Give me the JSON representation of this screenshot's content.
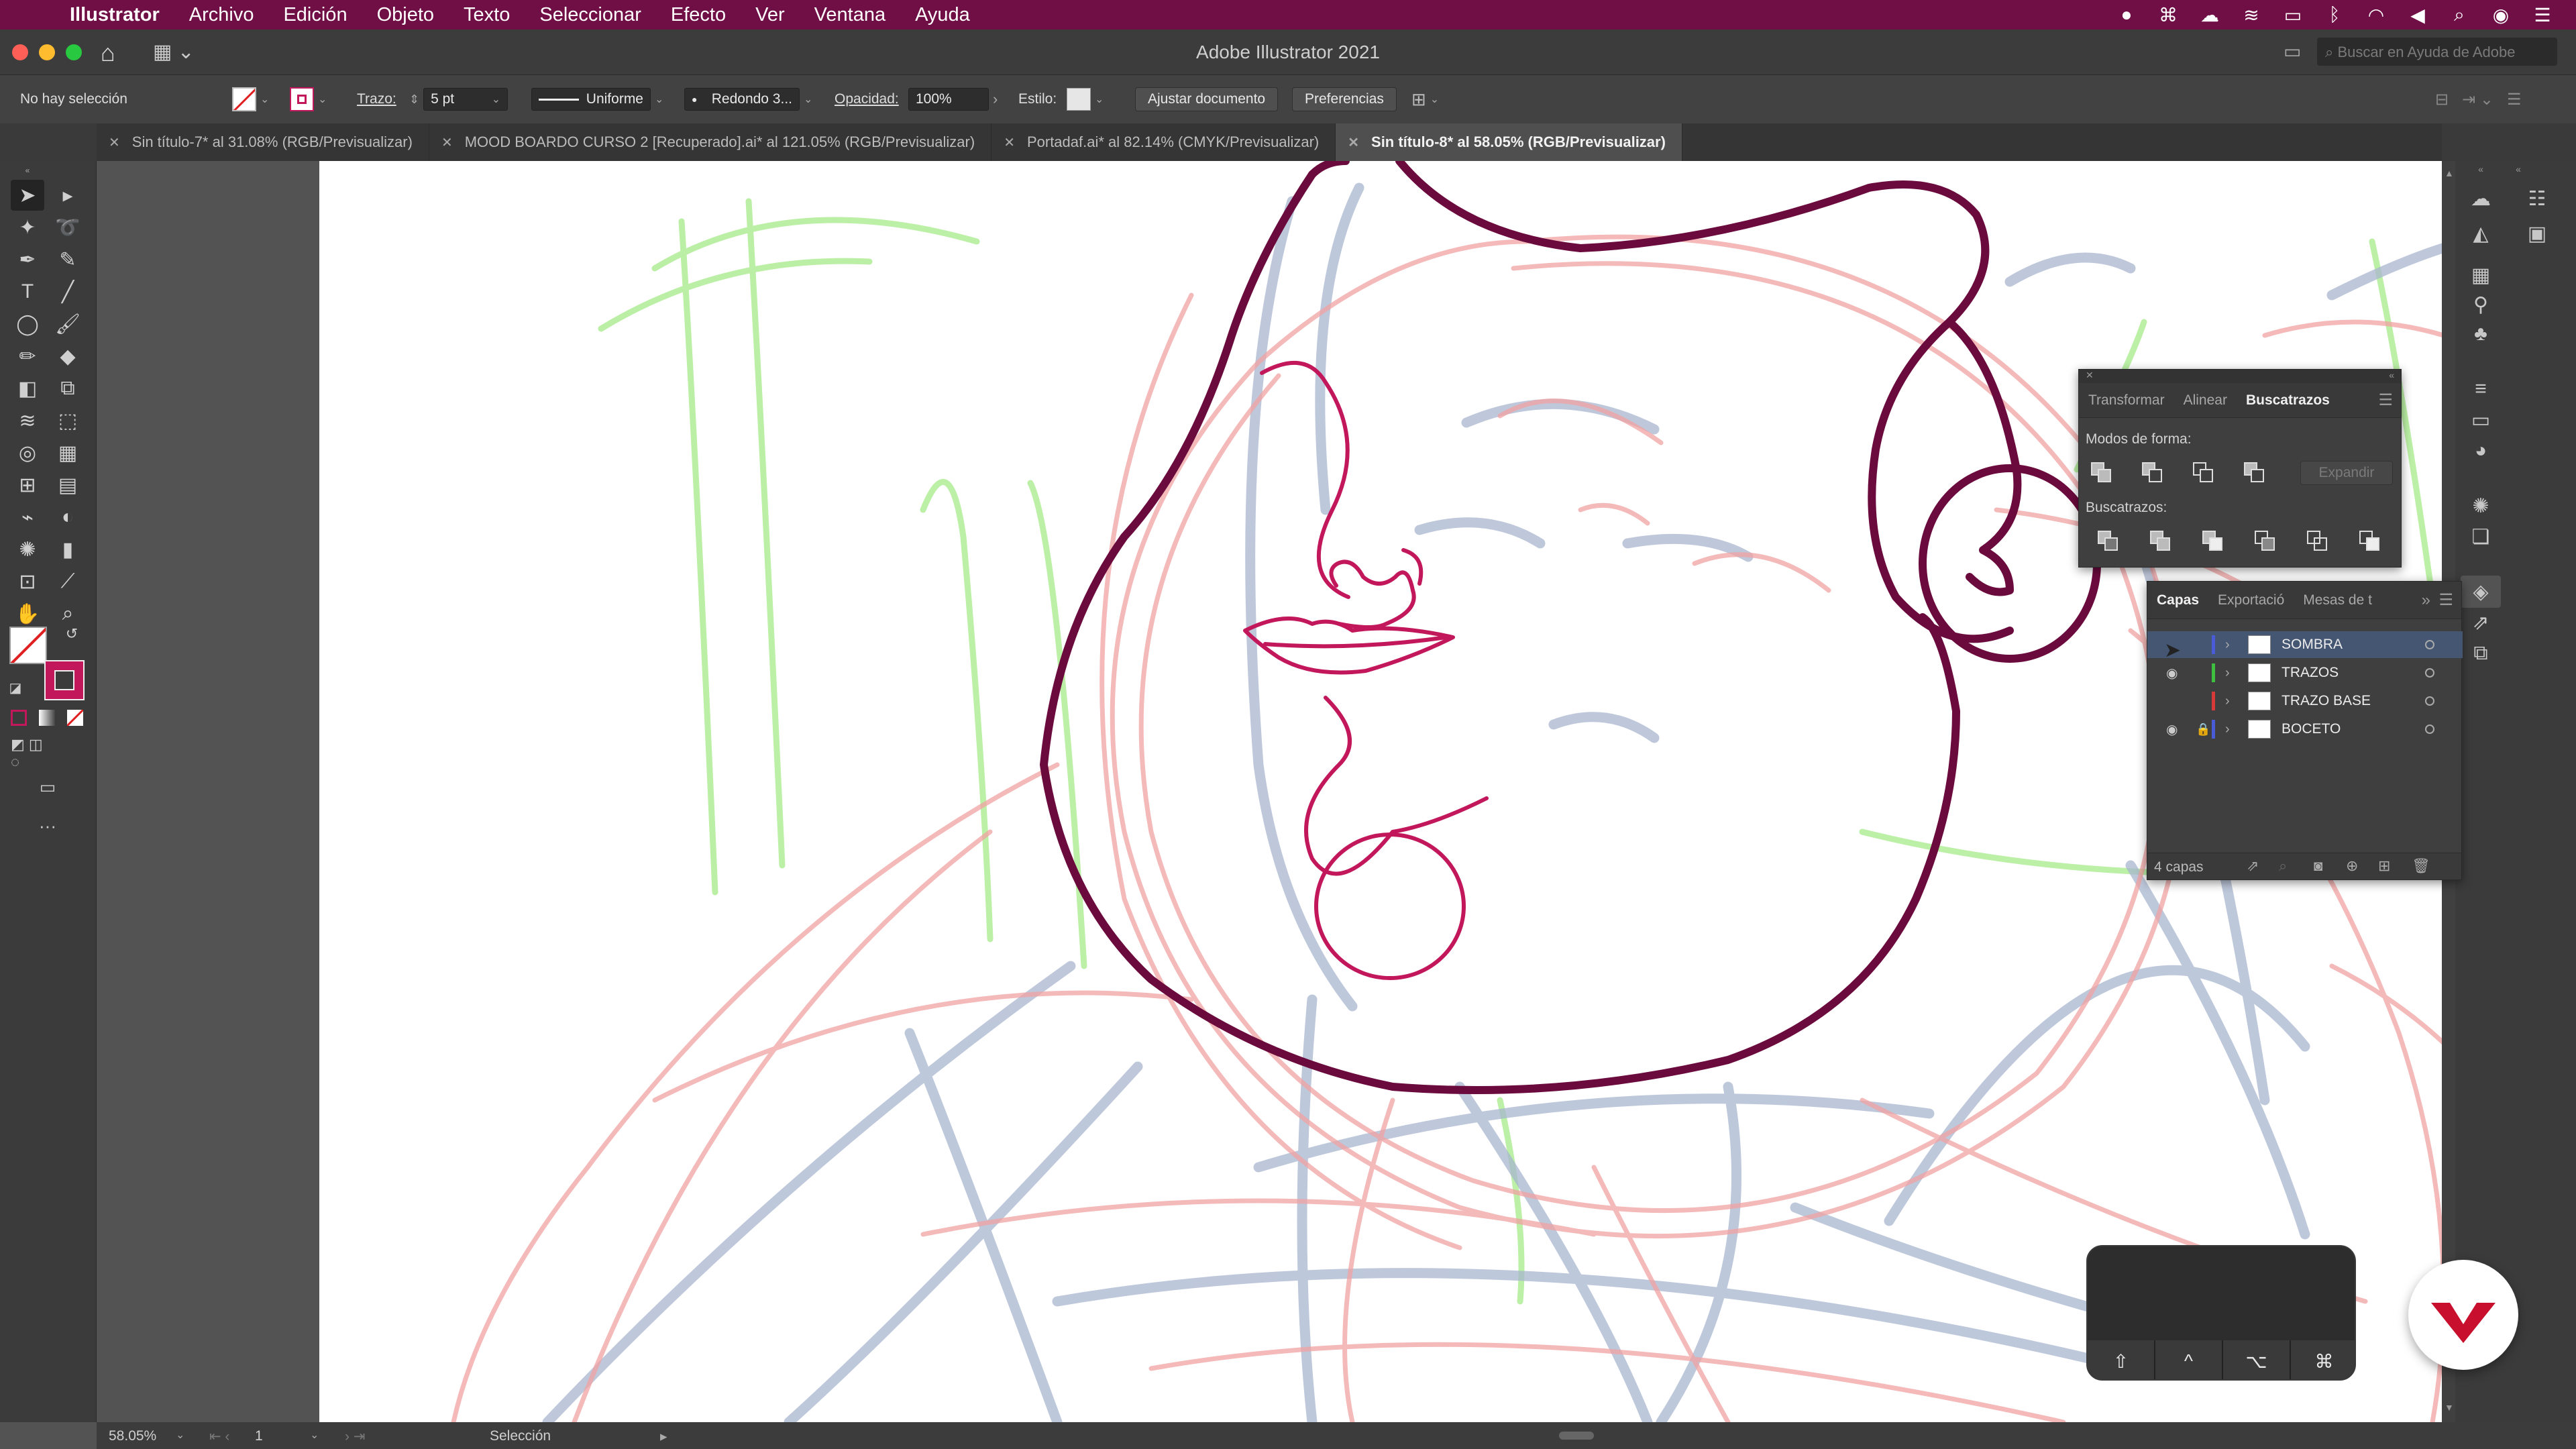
{
  "menubar": {
    "app": "Illustrator",
    "items": [
      "Archivo",
      "Edición",
      "Objeto",
      "Texto",
      "Seleccionar",
      "Efecto",
      "Ver",
      "Ventana",
      "Ayuda"
    ]
  },
  "window": {
    "title": "Adobe Illustrator 2021",
    "search_placeholder": "Buscar en Ayuda de Adobe"
  },
  "control_bar": {
    "selection_status": "No hay selección",
    "stroke_label": "Trazo:",
    "stroke_value": "5 pt",
    "profile_value": "Uniforme",
    "brush_value": "Redondo 3...",
    "opacity_label": "Opacidad:",
    "opacity_value": "100%",
    "style_label": "Estilo:",
    "fit_document_button": "Ajustar documento",
    "preferences_button": "Preferencias"
  },
  "tabs": [
    {
      "label": "Sin título-7* al 31.08% (RGB/Previsualizar)",
      "active": false
    },
    {
      "label": "MOOD BOARDO CURSO 2 [Recuperado].ai* al 121.05% (RGB/Previsualizar)",
      "active": false
    },
    {
      "label": "Portadaf.ai* al 82.14% (CMYK/Previsualizar)",
      "active": false
    },
    {
      "label": "Sin título-8* al 58.05% (RGB/Previsualizar)",
      "active": true
    }
  ],
  "pathfinder_panel": {
    "tabs": [
      "Transformar",
      "Alinear",
      "Buscatrazos"
    ],
    "active_tab": "Buscatrazos",
    "shape_modes_label": "Modos de forma:",
    "expand_button": "Expandir",
    "pathfinders_label": "Buscatrazos:"
  },
  "layers_panel": {
    "tabs": [
      "Capas",
      "Exportació",
      "Mesas de t"
    ],
    "active_tab": "Capas",
    "layers": [
      {
        "name": "SOMBRA",
        "color": "#4a5bd8",
        "visible": false,
        "locked": false,
        "selected": true
      },
      {
        "name": "TRAZOS",
        "color": "#3fbf3f",
        "visible": true,
        "locked": false,
        "selected": false
      },
      {
        "name": "TRAZO BASE",
        "color": "#d83a3a",
        "visible": false,
        "locked": false,
        "selected": false
      },
      {
        "name": "BOCETO",
        "color": "#4a5bd8",
        "visible": true,
        "locked": true,
        "selected": false
      }
    ],
    "count_label": "4 capas"
  },
  "status_bar": {
    "zoom": "58.05%",
    "artboard": "1",
    "tool": "Selección"
  },
  "keys_overlay": {
    "keys": [
      "⇧",
      "^",
      "⌥",
      "⌘"
    ]
  },
  "colors": {
    "menubar": "#6f0f45",
    "ink_dark": "#6b0a3d",
    "ink_magenta": "#c2185b",
    "sketch_red": "#f1a2a2",
    "sketch_blue": "#a9b6cf",
    "sketch_green": "#b4ee9c",
    "logo_red": "#c8102e"
  }
}
